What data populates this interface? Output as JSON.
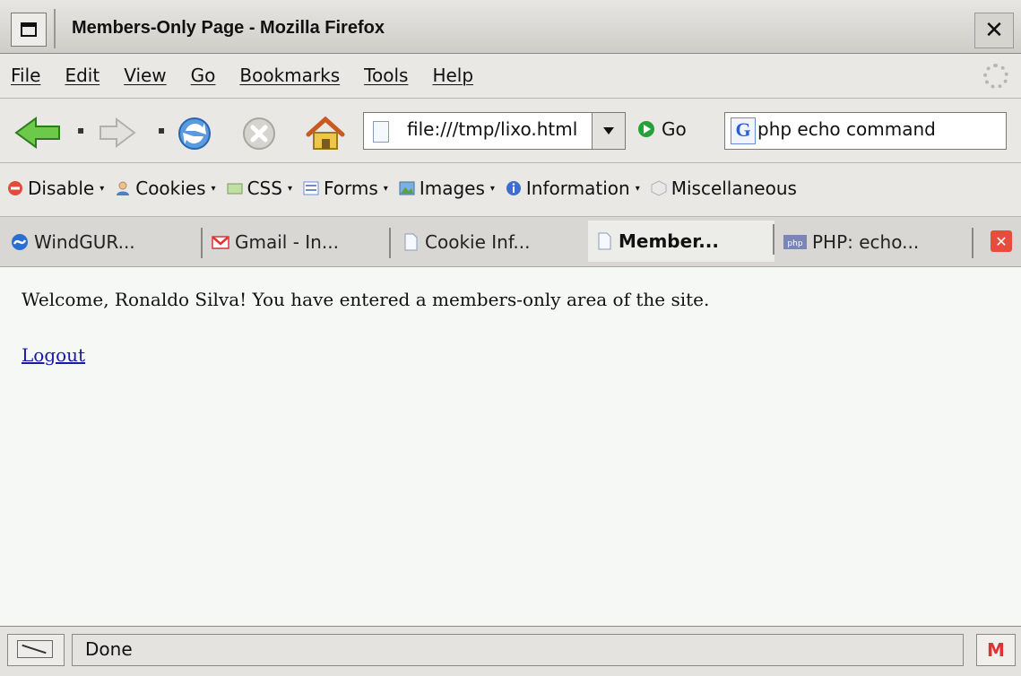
{
  "window": {
    "title": "Members-Only Page - Mozilla Firefox",
    "close_glyph": "✕"
  },
  "menu": {
    "items": [
      "File",
      "Edit",
      "View",
      "Go",
      "Bookmarks",
      "Tools",
      "Help"
    ]
  },
  "navigation": {
    "url": "file:///tmp/lixo.html",
    "go_label": "Go",
    "search_engine_letter": "G",
    "search_query": "php echo command"
  },
  "webdev_toolbar": {
    "items": [
      "Disable",
      "Cookies",
      "CSS",
      "Forms",
      "Images",
      "Information",
      "Miscellaneous"
    ]
  },
  "tabs": [
    {
      "label": "WindGUR...",
      "icon": "windguru-icon",
      "active": false
    },
    {
      "label": "Gmail - In...",
      "icon": "gmail-icon",
      "active": false
    },
    {
      "label": "Cookie Inf...",
      "icon": "page-icon",
      "active": false
    },
    {
      "label": "Member...",
      "icon": "page-icon",
      "active": true
    },
    {
      "label": "PHP: echo...",
      "icon": "php-icon",
      "active": false
    }
  ],
  "page": {
    "welcome": "Welcome, Ronaldo Silva! You have entered a members-only area of the site.",
    "logout": "Logout"
  },
  "status": {
    "text": "Done",
    "gmail_badge": "M"
  },
  "colors": {
    "link": "#1a1aa8",
    "content_bg": "#f6f8f6",
    "chrome_bg": "#e9e8e4"
  }
}
